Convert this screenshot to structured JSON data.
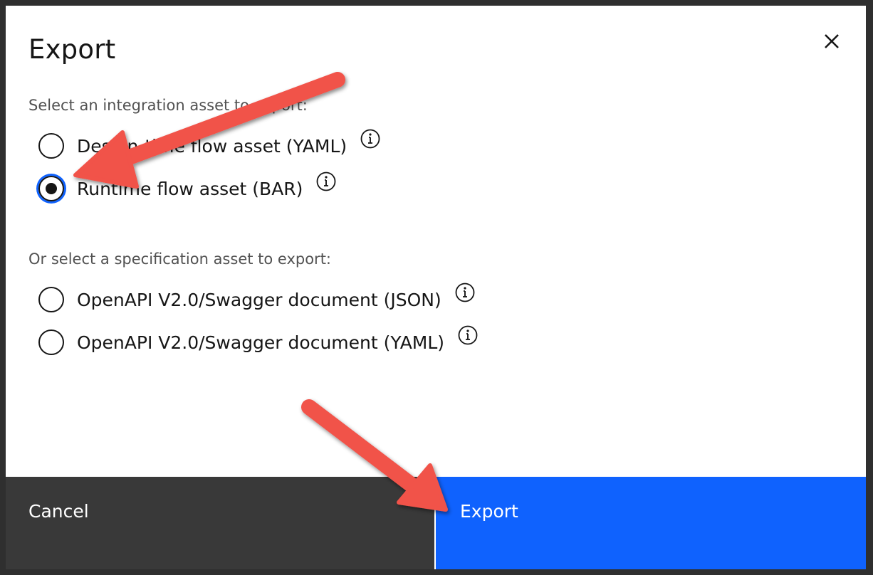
{
  "dialog": {
    "title": "Export",
    "close_icon": "close-icon"
  },
  "integration": {
    "label": "Select an integration asset to export:",
    "options": [
      {
        "label": "Design-time flow asset (YAML)",
        "selected": false,
        "info_icon": "information-icon"
      },
      {
        "label": "Runtime flow asset (BAR)",
        "selected": true,
        "info_icon": "information-icon"
      }
    ]
  },
  "specification": {
    "label": "Or select a specification asset to export:",
    "options": [
      {
        "label": "OpenAPI V2.0/Swagger document (JSON)",
        "selected": false,
        "info_icon": "information-icon"
      },
      {
        "label": "OpenAPI V2.0/Swagger document (YAML)",
        "selected": false,
        "info_icon": "information-icon"
      }
    ]
  },
  "footer": {
    "cancel_label": "Cancel",
    "export_label": "Export"
  },
  "colors": {
    "primary": "#0f62fe",
    "secondary": "#393939",
    "annotation_arrow": "#f1524a"
  }
}
